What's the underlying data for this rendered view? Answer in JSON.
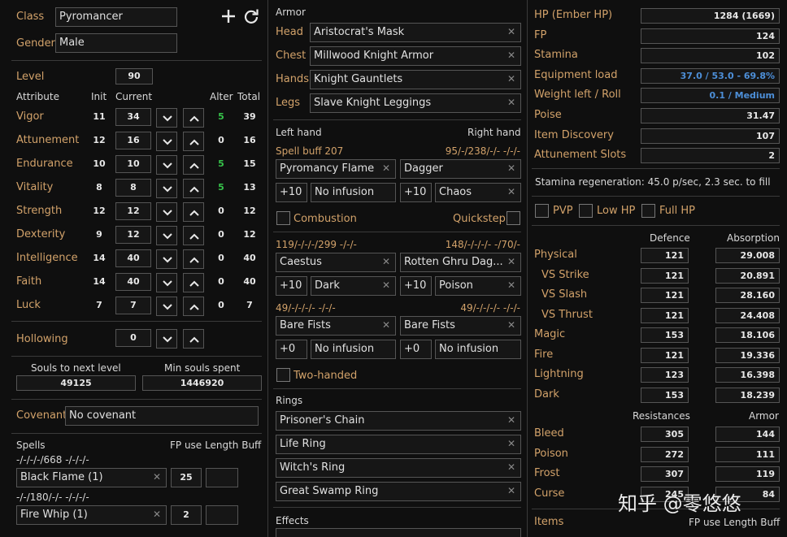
{
  "character": {
    "class_label": "Class",
    "class_value": "Pyromancer",
    "gender_label": "Gender",
    "gender_value": "Male",
    "level_label": "Level",
    "level_value": "90"
  },
  "attr_headers": {
    "attribute": "Attribute",
    "init": "Init",
    "current": "Current",
    "alter": "Alter",
    "total": "Total"
  },
  "attributes": [
    {
      "name": "Vigor",
      "init": "11",
      "current": "34",
      "alter": "5",
      "total": "39"
    },
    {
      "name": "Attunement",
      "init": "12",
      "current": "16",
      "alter": "0",
      "total": "16"
    },
    {
      "name": "Endurance",
      "init": "10",
      "current": "10",
      "alter": "5",
      "total": "15"
    },
    {
      "name": "Vitality",
      "init": "8",
      "current": "8",
      "alter": "5",
      "total": "13"
    },
    {
      "name": "Strength",
      "init": "12",
      "current": "12",
      "alter": "0",
      "total": "12"
    },
    {
      "name": "Dexterity",
      "init": "9",
      "current": "12",
      "alter": "0",
      "total": "12"
    },
    {
      "name": "Intelligence",
      "init": "14",
      "current": "40",
      "alter": "0",
      "total": "40"
    },
    {
      "name": "Faith",
      "init": "14",
      "current": "40",
      "alter": "0",
      "total": "40"
    },
    {
      "name": "Luck",
      "init": "7",
      "current": "7",
      "alter": "0",
      "total": "7"
    }
  ],
  "hollowing": {
    "label": "Hollowing",
    "value": "0"
  },
  "souls": {
    "next_label": "Souls to next level",
    "next_value": "49125",
    "min_label": "Min souls spent",
    "min_value": "1446920"
  },
  "covenant": {
    "label": "Covenant",
    "value": "No covenant"
  },
  "spells": {
    "label": "Spells",
    "header": "FP use Length Buff",
    "items": [
      {
        "stats": "-/-/-/-/668  -/-/-/-",
        "name": "Black Flame (1)",
        "fp": "25"
      },
      {
        "stats": "-/-/180/-/-  -/-/-/-",
        "name": "Fire Whip (1)",
        "fp": "2"
      }
    ]
  },
  "armor": {
    "label": "Armor",
    "slots": [
      {
        "slot": "Head",
        "item": "Aristocrat's Mask"
      },
      {
        "slot": "Chest",
        "item": "Millwood Knight Armor"
      },
      {
        "slot": "Hands",
        "item": "Knight Gauntlets"
      },
      {
        "slot": "Legs",
        "item": "Slave Knight Leggings"
      }
    ]
  },
  "hands": {
    "left_label": "Left hand",
    "right_label": "Right hand",
    "rows": [
      {
        "left_stats": "Spell buff 207",
        "right_stats": "95/-/238/-/-  -/-/-",
        "left_weapon": "Pyromancy Flame",
        "right_weapon": "Dagger",
        "left_upgrade": "+10",
        "left_infusion": "No infusion",
        "right_upgrade": "+10",
        "right_infusion": "Chaos",
        "left_check": "Combustion",
        "right_check": "Quickstep"
      },
      {
        "left_stats": "119/-/-/-/299  -/-/-",
        "right_stats": "148/-/-/-/-  -/70/-",
        "left_weapon": "Caestus",
        "right_weapon": "Rotten Ghru Dag...",
        "left_upgrade": "+10",
        "left_infusion": "Dark",
        "right_upgrade": "+10",
        "right_infusion": "Poison"
      },
      {
        "left_stats": "49/-/-/-/-  -/-/-",
        "right_stats": "49/-/-/-/-  -/-/-",
        "left_weapon": "Bare Fists",
        "right_weapon": "Bare Fists",
        "left_upgrade": "+0",
        "left_infusion": "No infusion",
        "right_upgrade": "+0",
        "right_infusion": "No infusion",
        "check": "Two-handed"
      }
    ]
  },
  "rings": {
    "label": "Rings",
    "items": [
      "Prisoner's Chain",
      "Life Ring",
      "Witch's Ring",
      "Great Swamp Ring"
    ]
  },
  "effects": {
    "label": "Effects"
  },
  "stats": [
    {
      "label": "HP (Ember HP)",
      "value": "1284 (1669)",
      "blue": false
    },
    {
      "label": "FP",
      "value": "124",
      "blue": false
    },
    {
      "label": "Stamina",
      "value": "102",
      "blue": false
    },
    {
      "label": "Equipment load",
      "value": "37.0 / 53.0 - 69.8%",
      "blue": true
    },
    {
      "label": "Weight left / Roll",
      "value": "0.1 / Medium",
      "blue": true
    },
    {
      "label": "Poise",
      "value": "31.47",
      "blue": false
    },
    {
      "label": "Item Discovery",
      "value": "107",
      "blue": false
    },
    {
      "label": "Attunement Slots",
      "value": "2",
      "blue": false
    }
  ],
  "stamina_regen": "Stamina regeneration: 45.0 p/sec, 2.3 sec. to fill",
  "toggles": [
    "PVP",
    "Low HP",
    "Full HP"
  ],
  "defence": {
    "defence_header": "Defence",
    "absorption_header": "Absorption",
    "rows": [
      {
        "name": "Physical",
        "def": "121",
        "abs": "29.008",
        "indent": false
      },
      {
        "name": "VS Strike",
        "def": "121",
        "abs": "20.891",
        "indent": true
      },
      {
        "name": "VS Slash",
        "def": "121",
        "abs": "28.160",
        "indent": true
      },
      {
        "name": "VS Thrust",
        "def": "121",
        "abs": "24.408",
        "indent": true
      },
      {
        "name": "Magic",
        "def": "153",
        "abs": "18.106",
        "indent": false
      },
      {
        "name": "Fire",
        "def": "121",
        "abs": "19.336",
        "indent": false
      },
      {
        "name": "Lightning",
        "def": "123",
        "abs": "16.398",
        "indent": false
      },
      {
        "name": "Dark",
        "def": "153",
        "abs": "18.239",
        "indent": false
      }
    ]
  },
  "resistances": {
    "res_header": "Resistances",
    "armor_header": "Armor",
    "rows": [
      {
        "name": "Bleed",
        "res": "305",
        "armor": "144"
      },
      {
        "name": "Poison",
        "res": "272",
        "armor": "111"
      },
      {
        "name": "Frost",
        "res": "307",
        "armor": "119"
      },
      {
        "name": "Curse",
        "res": "245",
        "armor": "84"
      }
    ]
  },
  "items": {
    "label": "Items",
    "header": "FP use Length Buff"
  },
  "watermark": "知乎 @零悠悠",
  "colors": {
    "label": "#d2a26a",
    "value_blue": "#4d8fd8",
    "alter_green": "#36c24a",
    "background": "#0f0f0f"
  }
}
